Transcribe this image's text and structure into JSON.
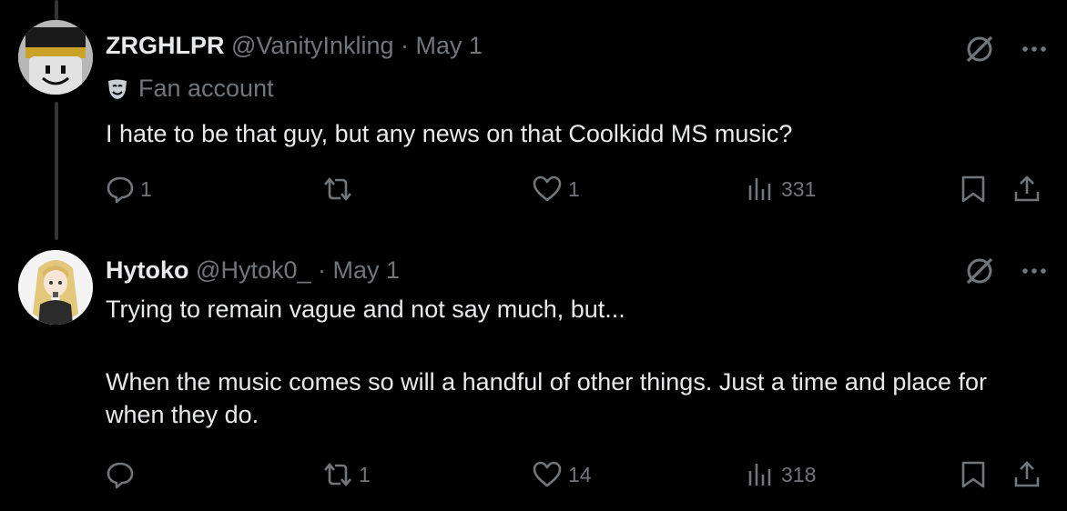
{
  "colors": {
    "background": "#000000",
    "text_primary": "#e7e9ea",
    "text_secondary": "#71767b",
    "thread_line": "#333639"
  },
  "tweets": [
    {
      "display_name": "ZRGHLPR",
      "handle": "@VanityInkling",
      "separator": "·",
      "date": "May 1",
      "label_icon": "theater-mask-icon",
      "label": "Fan account",
      "text": "I hate to be that guy, but any news on that Coolkidd MS music?",
      "replies": "1",
      "reposts": "",
      "likes": "1",
      "views": "331"
    },
    {
      "display_name": "Hytoko",
      "handle": "@Hytok0_",
      "separator": "·",
      "date": "May 1",
      "text_line1": "Trying to remain vague and not say much, but...",
      "text_line2": "When the music comes so will a handful of other things. Just a time and place for when they do.",
      "replies": "",
      "reposts": "1",
      "likes": "14",
      "views": "318"
    }
  ]
}
